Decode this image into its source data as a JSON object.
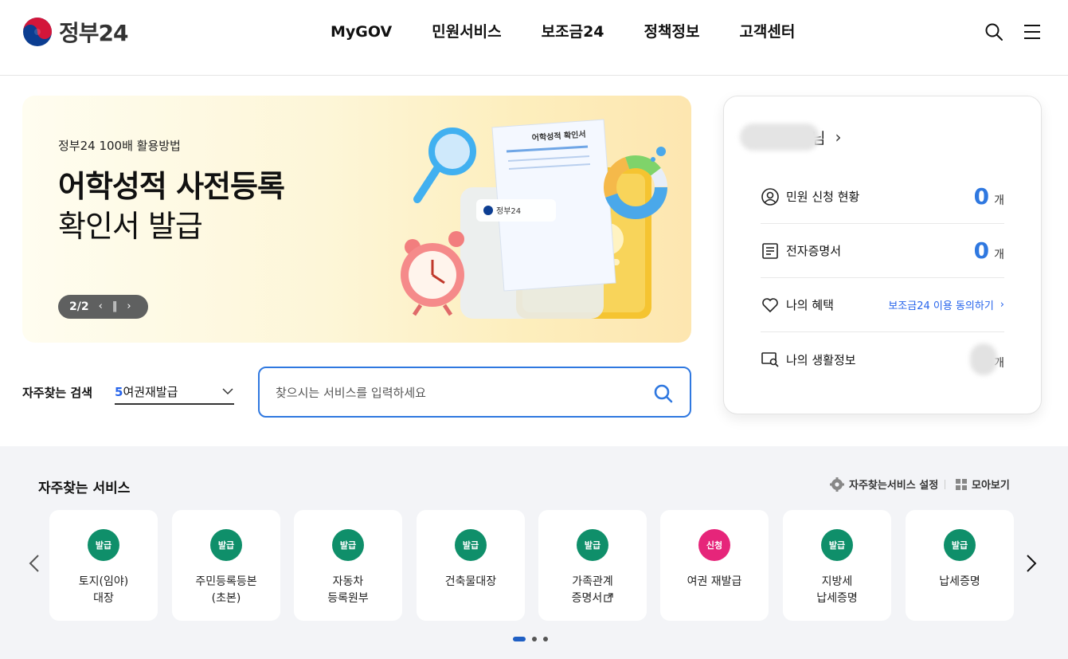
{
  "header": {
    "logo_text": "정부24",
    "nav": [
      "MyGOV",
      "민원서비스",
      "보조금24",
      "정책정보",
      "고객센터"
    ],
    "search_icon": "search-icon",
    "menu_icon": "hamburger-menu-icon"
  },
  "banner": {
    "eyebrow": "정부24 100배 활용방법",
    "title_line1": "어학성적 사전등록",
    "title_line2": "확인서 발급",
    "counter": "2/2",
    "document_title": "어학성적 확인서",
    "document_brand": "정부24"
  },
  "search": {
    "favorite_label": "자주찾는 검색",
    "selected_rank": "5",
    "selected_term": "여권재발급",
    "placeholder": "찾으시는 서비스를 입력하세요"
  },
  "user_panel": {
    "name_suffix": "님",
    "rows": [
      {
        "label": "민원 신청 현황",
        "count": "0",
        "unit": "개",
        "icon": "user-circle-icon"
      },
      {
        "label": "전자증명서",
        "count": "0",
        "unit": "개",
        "icon": "document-icon"
      },
      {
        "label": "나의 혜택",
        "link": "보조금24 이용 동의하기",
        "icon": "heart-icon"
      },
      {
        "label": "나의 생활정보",
        "unit": "개",
        "icon": "monitor-search-icon"
      }
    ]
  },
  "services": {
    "title": "자주찾는 서비스",
    "setting_label": "자주찾는서비스 설정",
    "view_all_label": "모아보기",
    "cards": [
      {
        "badge": "발급",
        "line1": "토지(임야)",
        "line2": "대장",
        "color": "#0f8f6a"
      },
      {
        "badge": "발급",
        "line1": "주민등록등본",
        "line2": "(초본)",
        "color": "#0f8f6a"
      },
      {
        "badge": "발급",
        "line1": "자동차",
        "line2": "등록원부",
        "color": "#0f8f6a"
      },
      {
        "badge": "발급",
        "line1": "건축물대장",
        "line2": "",
        "color": "#0f8f6a"
      },
      {
        "badge": "발급",
        "line1": "가족관계",
        "line2": "증명서",
        "color": "#0f8f6a"
      },
      {
        "badge": "신청",
        "line1": "여권 재발급",
        "line2": "",
        "color": "#e6257a"
      },
      {
        "badge": "발급",
        "line1": "지방세",
        "line2": "납세증명",
        "color": "#0f8f6a"
      },
      {
        "badge": "발급",
        "line1": "납세증명",
        "line2": "",
        "color": "#0f8f6a"
      }
    ]
  },
  "colors": {
    "accent_blue": "#2f78e0",
    "issue_green": "#0f8f6a",
    "apply_pink": "#e6257a"
  }
}
